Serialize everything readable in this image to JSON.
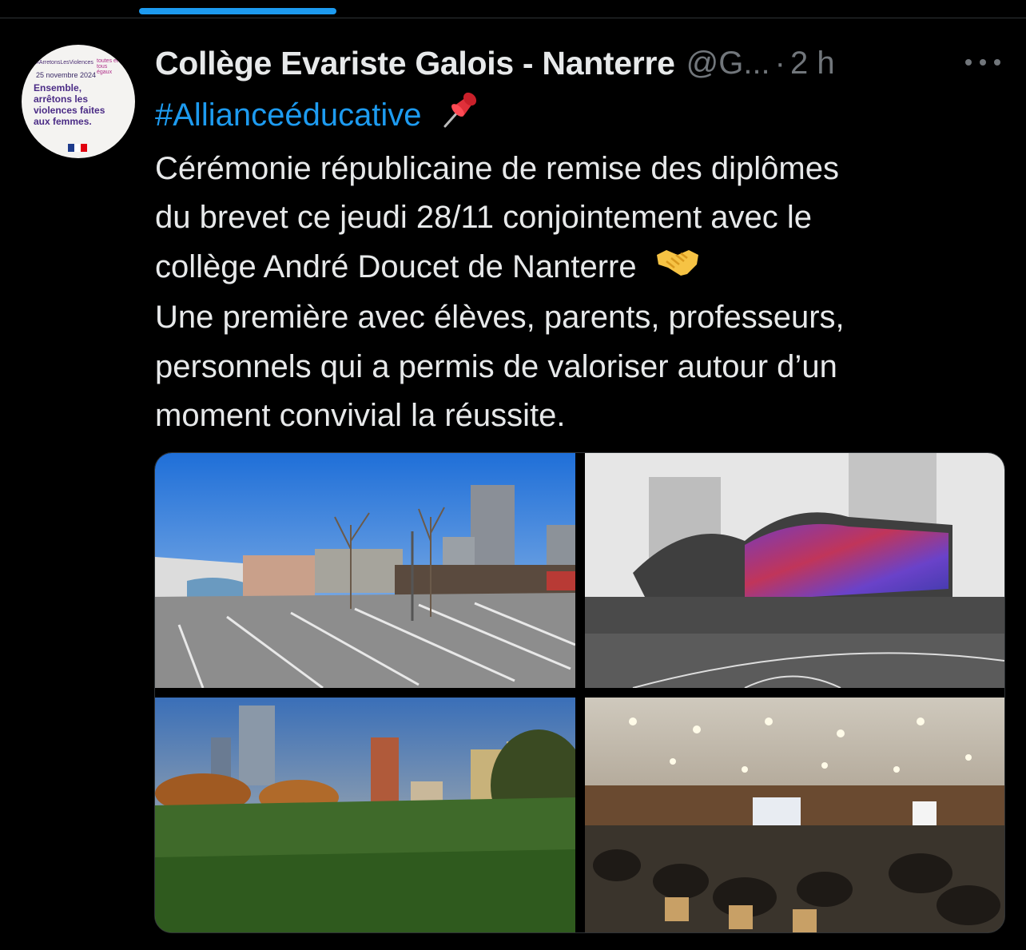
{
  "tweet": {
    "author_name": "Collège Evariste Galois - Nanterre",
    "handle": "@G...",
    "separator": "·",
    "timestamp": "2 h",
    "hashtag": "#Allianceéducative",
    "text_lines": [
      "Cérémonie républicaine de remise des diplômes",
      "du brevet ce jeudi 28/11 conjointement avec le",
      "collège André Doucet de Nanterre",
      "Une première avec élèves, parents, professeurs,",
      "personnels qui a permis de valoriser autour d’un",
      "moment convivial la réussite."
    ],
    "emojis": [
      "pushpin-emoji",
      "handshake-emoji"
    ]
  },
  "avatar": {
    "hashtag": "#ArretonsLesViolences",
    "date": "25 novembre 2024",
    "message": "Ensemble, arrêtons les violences faites aux femmes.",
    "corner_text": "toutes et tous égaux"
  },
  "media": {
    "photos": [
      "schoolyard-parking-photo",
      "gymnasium-mural-photo",
      "park-towers-photo",
      "ceremony-hall-photo"
    ]
  },
  "colors": {
    "background": "#000000",
    "text": "#e7e9ea",
    "secondary": "#71767b",
    "accent": "#1d9bf0"
  }
}
